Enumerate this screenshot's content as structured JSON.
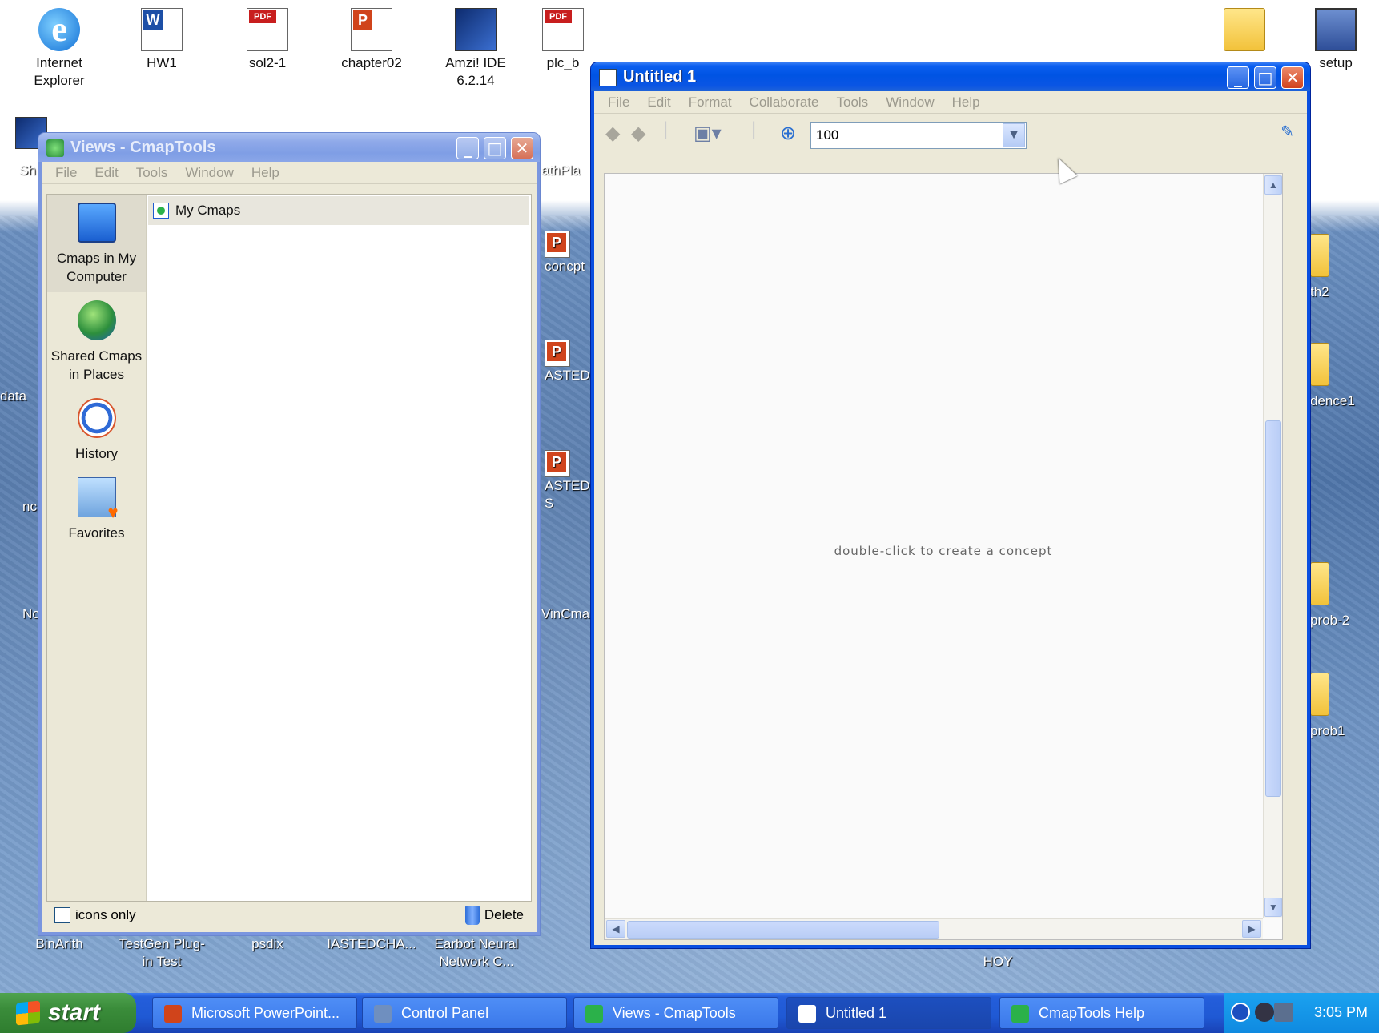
{
  "desktop": {
    "icons": [
      {
        "label": "Internet Explorer",
        "icon": "ie-icon"
      },
      {
        "label": "HW1",
        "icon": "word-doc-icon"
      },
      {
        "label": "sol2-1",
        "icon": "pdf-icon"
      },
      {
        "label": "chapter02",
        "icon": "ppt-icon"
      },
      {
        "label": "Amzi! IDE 6.2.14",
        "icon": "app-shortcut-icon"
      },
      {
        "label": "plc_b",
        "icon": "pdf-icon"
      },
      {
        "label": "setup",
        "icon": "computer-icon"
      },
      {
        "label": "BinArith",
        "icon": "file-icon"
      },
      {
        "label": "TestGen Plug-in Test",
        "icon": "file-icon"
      },
      {
        "label": "psdix",
        "icon": "file-icon"
      },
      {
        "label": "IASTEDCHA...",
        "icon": "file-icon"
      },
      {
        "label": "Earbot Neural Network C...",
        "icon": "file-icon"
      },
      {
        "label": "HOY",
        "icon": "file-icon"
      },
      {
        "label": "th2",
        "icon": "folder-icon"
      },
      {
        "label": "dence1",
        "icon": "folder-icon"
      },
      {
        "label": "prob-2",
        "icon": "folder-icon"
      },
      {
        "label": "prob1",
        "icon": "folder-icon"
      },
      {
        "label": "concpt",
        "icon": "ppt-icon"
      },
      {
        "label": "ASTED-",
        "icon": "ppt-icon"
      },
      {
        "label": "ASTED-S",
        "icon": "ppt-icon"
      },
      {
        "label": "athPla",
        "icon": "app-icon"
      },
      {
        "label": "VinCma",
        "icon": "app-icon"
      },
      {
        "label": "Sh",
        "icon": "file-icon"
      },
      {
        "label": "data",
        "icon": "file-icon"
      },
      {
        "label": "nc",
        "icon": "file-icon"
      },
      {
        "label": "No",
        "icon": "file-icon"
      }
    ]
  },
  "views_window": {
    "title": "Views - CmapTools",
    "menu": [
      "File",
      "Edit",
      "Tools",
      "Window",
      "Help"
    ],
    "nav": [
      {
        "label": "Cmaps in My Computer",
        "selected": true
      },
      {
        "label": "Shared Cmaps in Places",
        "selected": false
      },
      {
        "label": "History",
        "selected": false
      },
      {
        "label": "Favorites",
        "selected": false
      }
    ],
    "list": [
      {
        "label": "My Cmaps"
      }
    ],
    "icons_only_label": "icons only",
    "icons_only_checked": false,
    "delete_label": "Delete"
  },
  "untitled_window": {
    "title": "Untitled 1",
    "menu": [
      "File",
      "Edit",
      "Format",
      "Collaborate",
      "Tools",
      "Window",
      "Help"
    ],
    "zoom_value": "100",
    "canvas_hint": "double-click to create a concept"
  },
  "taskbar": {
    "start_label": "start",
    "tasks": [
      {
        "label": "Microsoft PowerPoint...",
        "color": "#d0441b"
      },
      {
        "label": "Control Panel",
        "color": "#6f8fbf"
      },
      {
        "label": "Views - CmapTools",
        "color": "#2bb14a"
      },
      {
        "label": "Untitled 1",
        "color": "#3a64a8"
      },
      {
        "label": "CmapTools Help",
        "color": "#2bb14a"
      }
    ],
    "clock": "3:05 PM"
  },
  "colors": {
    "titlebar_active": "#0054e3",
    "titlebar_inactive": "#7f9ee5",
    "taskbar": "#245edb",
    "start_green": "#3a8c3a"
  }
}
